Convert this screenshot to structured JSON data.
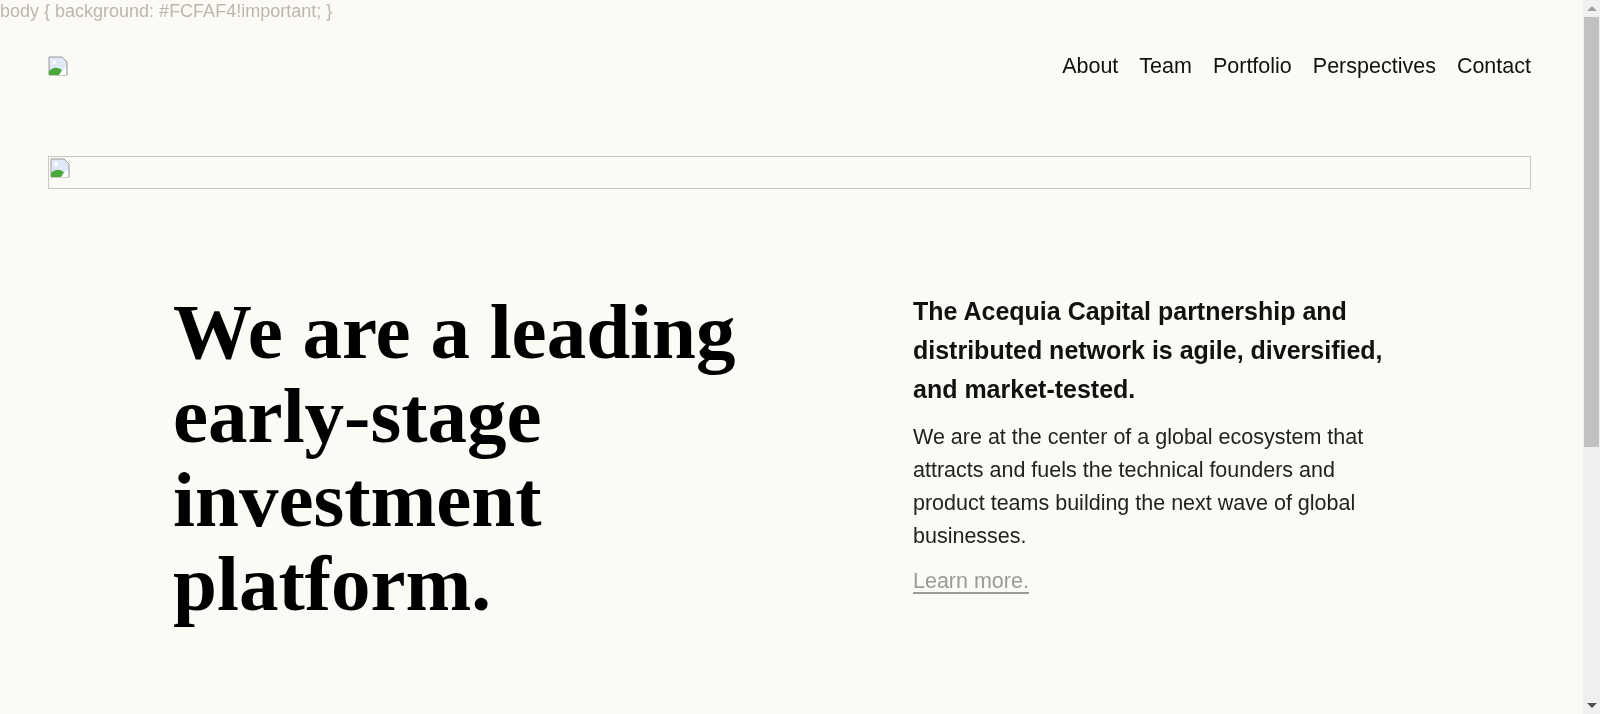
{
  "style_text": "body { background: #FCFAF4!important; }",
  "nav": [
    {
      "label": "About"
    },
    {
      "label": "Team"
    },
    {
      "label": "Portfolio"
    },
    {
      "label": "Perspectives"
    },
    {
      "label": "Contact"
    }
  ],
  "hero": {
    "heading": "We are a leading early-stage investment platform.",
    "intro": "The Acequia Capital partnership and distributed network is agile, diversified, and market-tested.",
    "body": "We are at the center of a global ecosystem that attracts and fuels the technical founders and product teams building the next wave of global businesses.",
    "link": "Learn more."
  }
}
